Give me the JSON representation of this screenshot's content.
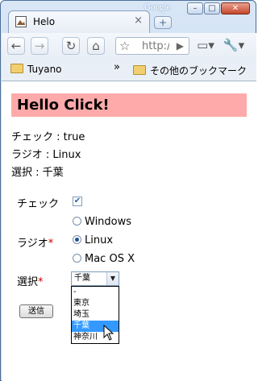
{
  "browser": {
    "brand": "Google",
    "tab_title": "Helo",
    "new_tab": "+",
    "omnibox_url": "http://",
    "window_buttons": [
      "–",
      "□",
      "✕"
    ]
  },
  "bookmarks": {
    "left": "Tuyano",
    "chevron": "»",
    "right": "その他のブックマーク"
  },
  "page": {
    "heading": "Hello Click!",
    "heading_bg": "#ffaaaa",
    "status_check": "チェック : true",
    "status_radio": "ラジオ : Linux",
    "status_select": "選択 : 千葉",
    "form": {
      "check_label": "チェック",
      "check_value": true,
      "radio_label": "ラジオ",
      "required_mark": "*",
      "radio_options": [
        "Windows",
        "Linux",
        "Mac OS X"
      ],
      "radio_selected_index": 1,
      "select_label": "選択",
      "select_value": "千葉",
      "select_options": [
        "-",
        "東京",
        "埼玉",
        "千葉",
        "神奈川"
      ],
      "select_highlight_index": 3,
      "submit_label": "送信"
    }
  }
}
